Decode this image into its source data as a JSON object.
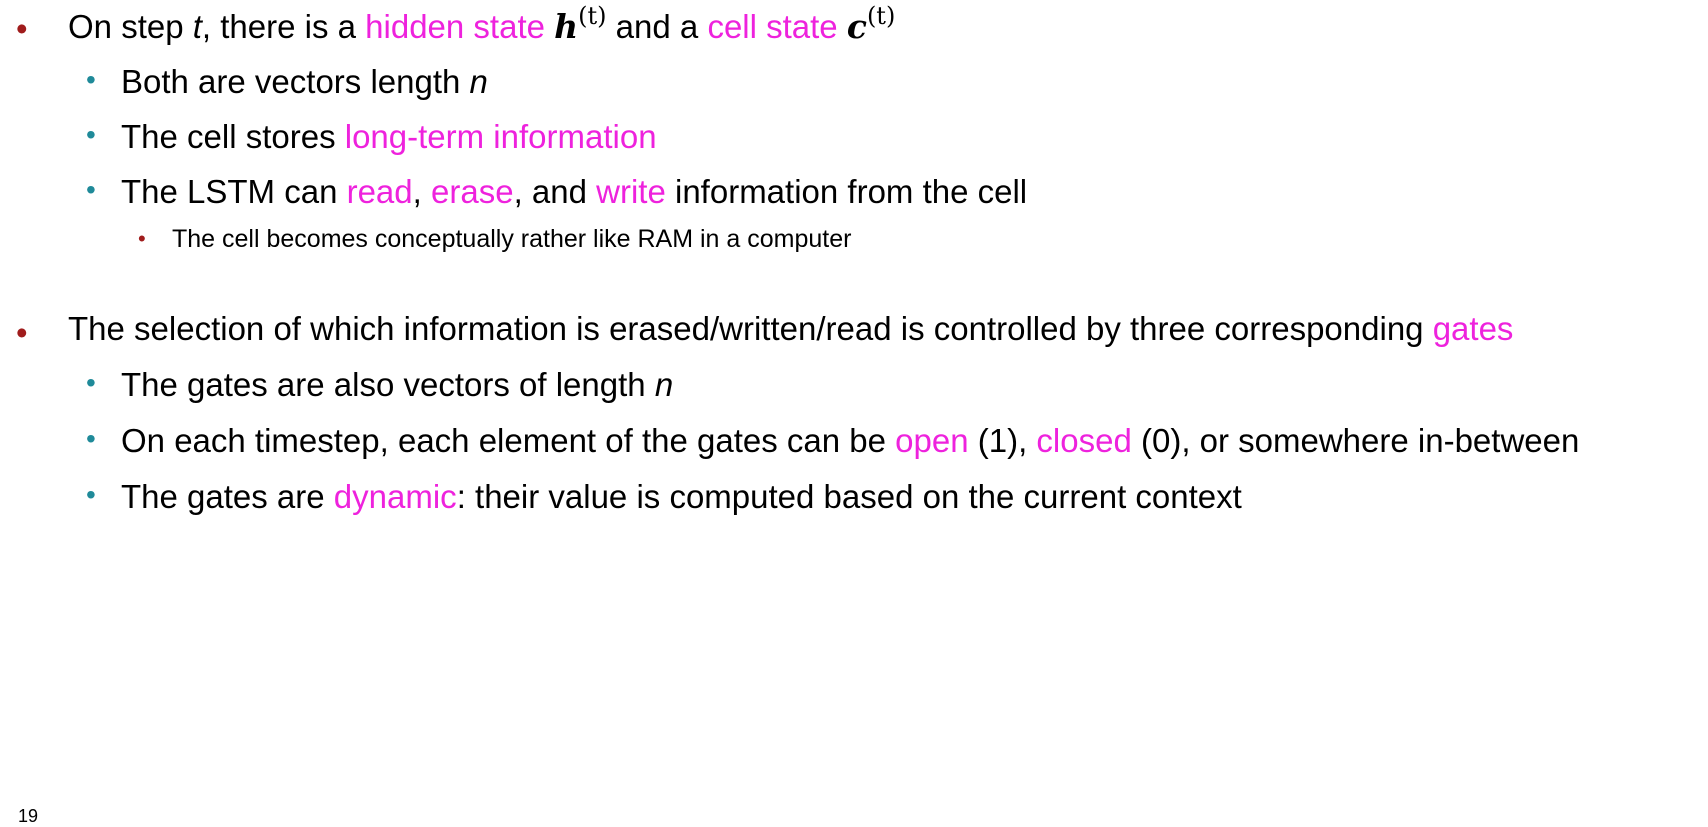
{
  "colors": {
    "highlight": "#ee22dd",
    "bullet_level1": "#a01c1c",
    "bullet_level2": "#1f8a99",
    "bullet_level3": "#a01c1c"
  },
  "bullets": [
    {
      "t1": "On step ",
      "t2": "t",
      "t3": ", there is a ",
      "h1": "hidden state",
      "m1": "h",
      "s1": "(t)",
      "t4": " and a ",
      "h2": "cell state",
      "m2": "c",
      "s2": "(t)",
      "children": [
        {
          "t1": "Both are vectors length ",
          "t2": "n"
        },
        {
          "t1": "The cell stores ",
          "h1": "long-term information"
        },
        {
          "t1": "The LSTM can ",
          "h1": "read",
          "t2": ", ",
          "h2": "erase",
          "t3": ", and ",
          "h3": "write",
          "t4": " information from the cell",
          "children": [
            {
              "t1": "The cell becomes conceptually rather like RAM in a computer"
            }
          ]
        }
      ]
    },
    {
      "t1": "The selection of which information is erased/written/read is controlled by three corresponding ",
      "h1": "gates",
      "children": [
        {
          "t1": "The gates are also vectors of length ",
          "t2": "n"
        },
        {
          "t1": "On each timestep, each element of the gates can be ",
          "h1": "open",
          "t2": " (1), ",
          "h2": "closed",
          "t3": " (0), or somewhere in-between"
        },
        {
          "t1": "The gates are ",
          "h1": "dynamic",
          "t2": ": their value is computed based on the current context"
        }
      ]
    }
  ],
  "page_number": "19"
}
